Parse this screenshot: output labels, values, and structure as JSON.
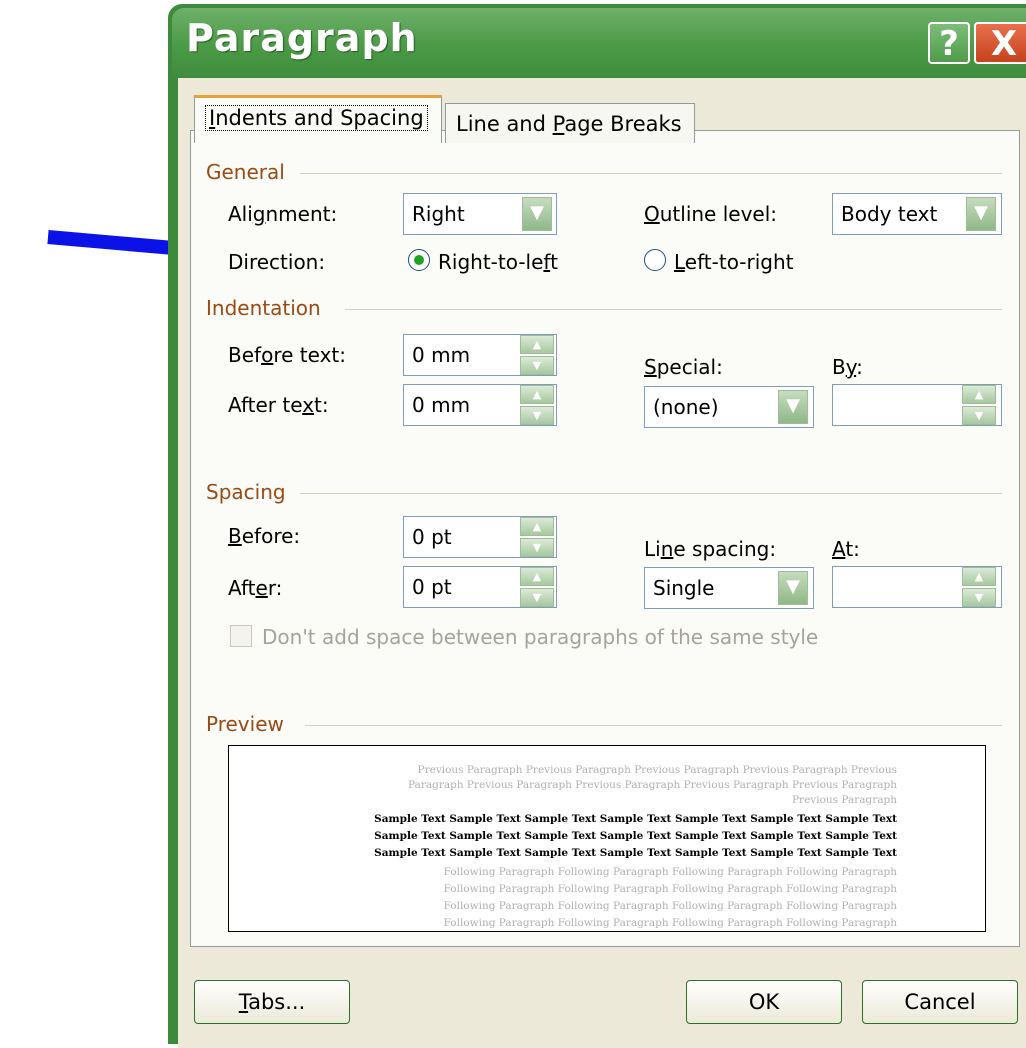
{
  "window": {
    "title": "Paragraph",
    "help_label": "?",
    "close_label": "X"
  },
  "tabs": [
    {
      "label_pre": "",
      "label_u": "I",
      "label_post": "ndents and Spacing"
    },
    {
      "label_pre": "Line and ",
      "label_u": "P",
      "label_post": "age Breaks"
    }
  ],
  "general": {
    "section": "General",
    "alignment_label_pre": "Ali",
    "alignment_label_u": "g",
    "alignment_label_post": "nment:",
    "alignment_value": "Right",
    "outline_label_pre": "",
    "outline_label_u": "O",
    "outline_label_post": "utline level:",
    "outline_value": "Body text",
    "direction_label": "Direction:",
    "rtl_label_pre": "Right-to-le",
    "rtl_label_u": "f",
    "rtl_label_post": "t",
    "ltr_label_pre": "",
    "ltr_label_u": "L",
    "ltr_label_post": "eft-to-right"
  },
  "indentation": {
    "section": "Indentation",
    "before_label_pre": "Bef",
    "before_label_u": "o",
    "before_label_post": "re text:",
    "before_value": "0 mm",
    "after_label_pre": "After te",
    "after_label_u": "x",
    "after_label_post": "t:",
    "after_value": "0 mm",
    "special_label_pre": "",
    "special_label_u": "S",
    "special_label_post": "pecial:",
    "special_value": "(none)",
    "by_label_pre": "B",
    "by_label_u": "y",
    "by_label_post": ":",
    "by_value": ""
  },
  "spacing": {
    "section": "Spacing",
    "before_label_pre": "",
    "before_label_u": "B",
    "before_label_post": "efore:",
    "before_value": "0 pt",
    "after_label_pre": "Aft",
    "after_label_u": "e",
    "after_label_post": "r:",
    "after_value": "0 pt",
    "line_label_pre": "Li",
    "line_label_u": "n",
    "line_label_post": "e spacing:",
    "line_value": "Single",
    "at_label_pre": "",
    "at_label_u": "A",
    "at_label_post": "t:",
    "at_value": "",
    "dont_add_label": "Don't add space between paragraphs of the same style"
  },
  "preview": {
    "section": "Preview",
    "prev_lines": [
      "Previous Paragraph Previous Paragraph Previous Paragraph Previous Paragraph Previous",
      "Paragraph Previous Paragraph Previous Paragraph Previous Paragraph Previous Paragraph",
      "Previous Paragraph"
    ],
    "sample_lines": [
      "Sample Text Sample Text Sample Text Sample Text Sample Text Sample Text Sample Text",
      "Sample Text Sample Text Sample Text Sample Text Sample Text Sample Text Sample Text",
      "Sample Text Sample Text Sample Text Sample Text Sample Text Sample Text Sample Text"
    ],
    "follow_lines": [
      "Following Paragraph Following Paragraph Following Paragraph Following Paragraph",
      "Following Paragraph Following Paragraph Following Paragraph Following Paragraph",
      "Following Paragraph Following Paragraph Following Paragraph Following Paragraph",
      "Following Paragraph Following Paragraph Following Paragraph Following Paragraph"
    ]
  },
  "buttons": {
    "tabs_pre": "",
    "tabs_u": "T",
    "tabs_post": "abs...",
    "ok": "OK",
    "cancel": "Cancel"
  },
  "colors": {
    "annotation_arrow": "#0a12e8",
    "title_bar": "#4b9a47",
    "section_heading": "#9c4a14"
  }
}
